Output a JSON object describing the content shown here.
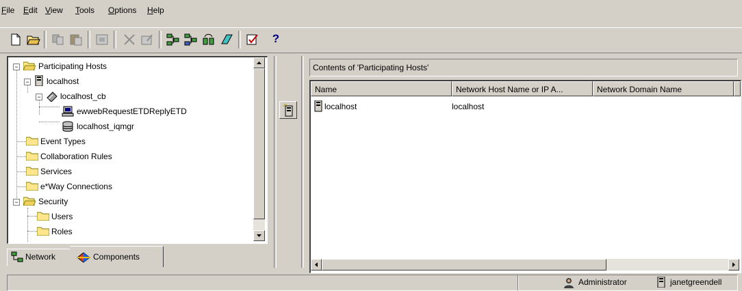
{
  "menu": {
    "items": [
      {
        "label": "File",
        "key": "F"
      },
      {
        "label": "Edit",
        "key": "E"
      },
      {
        "label": "View",
        "key": "V"
      },
      {
        "label": "Tools",
        "key": "T"
      },
      {
        "label": "Options",
        "key": "O"
      },
      {
        "label": "Help",
        "key": "H"
      }
    ]
  },
  "toolbar": {
    "buttons": [
      "new-icon",
      "open-folder-icon",
      "copy-icon",
      "paste-icon",
      "properties-icon",
      "delete-icon",
      "edit-icon",
      "network-add-icon",
      "network-remove-icon",
      "deploy-icon",
      "erase-icon",
      "check-icon",
      "help-icon"
    ],
    "help_label": "?"
  },
  "tree": {
    "items": [
      {
        "label": "Participating Hosts",
        "icon": "folder-open-icon"
      },
      {
        "label": "localhost",
        "icon": "host-icon"
      },
      {
        "label": "localhost_cb",
        "icon": "control-broker-icon"
      },
      {
        "label": "ewwebRequestETDReplyETD",
        "icon": "computer-icon"
      },
      {
        "label": "localhost_iqmgr",
        "icon": "database-icon"
      },
      {
        "label": "Event Types",
        "icon": "folder-icon"
      },
      {
        "label": "Collaboration Rules",
        "icon": "folder-icon"
      },
      {
        "label": "Services",
        "icon": "folder-icon"
      },
      {
        "label": "e*Way Connections",
        "icon": "folder-icon"
      },
      {
        "label": "Security",
        "icon": "folder-open-icon"
      },
      {
        "label": "Users",
        "icon": "folder-icon"
      },
      {
        "label": "Roles",
        "icon": "folder-icon"
      }
    ]
  },
  "tabs": [
    {
      "label": "Network",
      "icon": "network-icon",
      "selected": false
    },
    {
      "label": "Components",
      "icon": "components-icon",
      "selected": true
    }
  ],
  "contents": {
    "title": "Contents of  'Participating Hosts'",
    "columns": [
      "Name",
      "Network Host Name or IP A...",
      "Network Domain Name"
    ],
    "rows": [
      {
        "name": "localhost",
        "host": "localhost",
        "domain": ""
      }
    ]
  },
  "status": {
    "left_text": "",
    "user_role": "Administrator",
    "user_name": "janetgreendell"
  }
}
